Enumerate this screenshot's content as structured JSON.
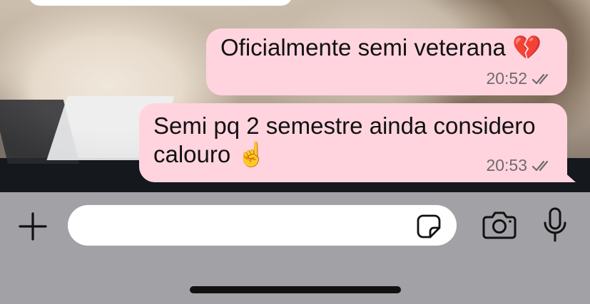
{
  "messages": [
    {
      "text": "Oficialmente semi veterana 💔",
      "time": "20:52",
      "status": "read"
    },
    {
      "text": "Semi pq 2 semestre ainda considero\ncalouro ☝️",
      "time": "20:53",
      "status": "read"
    }
  ],
  "composer": {
    "value": "",
    "placeholder": ""
  },
  "icons": {
    "add": "plus-icon",
    "sticker": "sticker-icon",
    "camera": "camera-icon",
    "mic": "microphone-icon",
    "read_receipt": "double-check-icon"
  },
  "colors": {
    "bubble_outgoing": "#ffd4df",
    "input_bar": "#a1a1a6",
    "chat_background": "#15181d",
    "meta_text": "#6f6a6c"
  }
}
